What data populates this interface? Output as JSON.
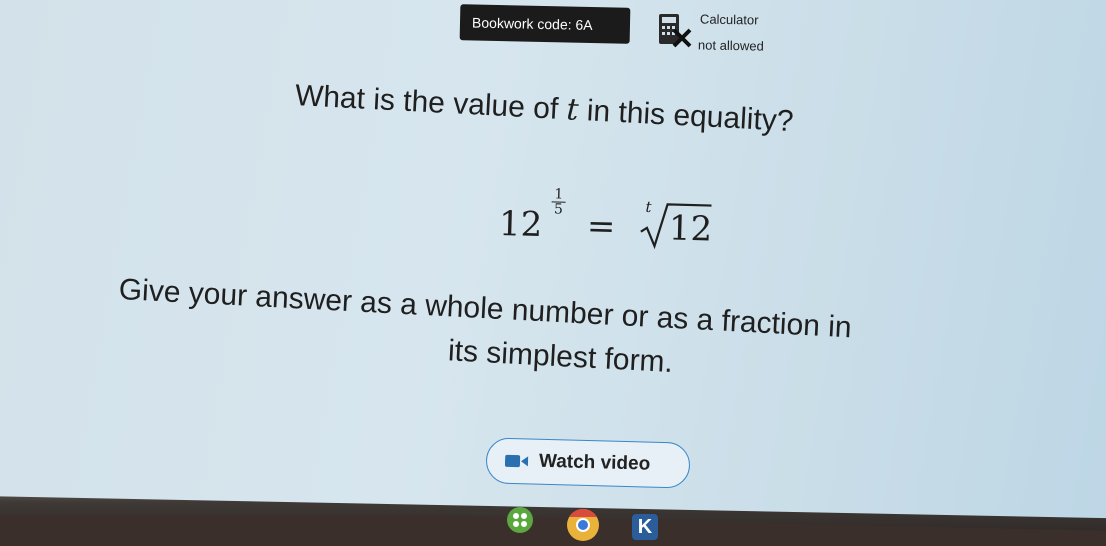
{
  "header": {
    "bookwork_code": "Bookwork code: 6A",
    "calculator_title": "Calculator",
    "calculator_status": "not allowed"
  },
  "question": {
    "text_before": "What is the value of ",
    "variable": "t",
    "text_after": " in this equality?"
  },
  "equation": {
    "base": "12",
    "exponent_numerator": "1",
    "exponent_denominator": "5",
    "equals": "=",
    "root_index": "t",
    "radicand": "12"
  },
  "instruction": {
    "line1": "Give your answer as a whole number or as a fraction in",
    "line2": "its simplest form."
  },
  "watch_video": {
    "label": "Watch video"
  },
  "taskbar": {
    "icons": [
      "launcher-icon",
      "chrome-icon",
      "k-app-icon"
    ],
    "k_letter": "K"
  },
  "colors": {
    "background": "#d3e2ea",
    "bookwork_bg": "#1b1b1b",
    "accent": "#3a87c8",
    "calculator_cross": "#1a1a1a"
  }
}
